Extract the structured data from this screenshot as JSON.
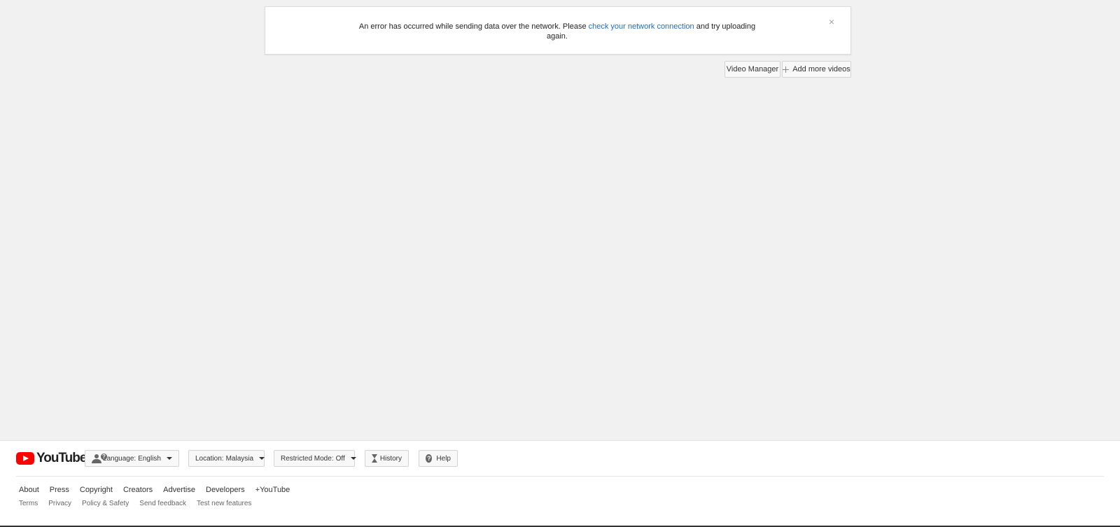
{
  "notice": {
    "text_before": "An error has occurred while sending data over the network. Please ",
    "link_text": "check your network connection",
    "text_after": " and try uploading again.",
    "close_glyph": "×"
  },
  "actions": {
    "video_manager": "Video Manager",
    "add_more_videos": "Add more videos"
  },
  "footer": {
    "logo_text": "YouTube",
    "language_label": "Language:",
    "language_value": "English",
    "location_label": "Location:",
    "location_value": "Malaysia",
    "restricted_label": "Restricted Mode:",
    "restricted_value": "Off",
    "history": "History",
    "help": "Help",
    "help_glyph": "?",
    "people_glyph": "?",
    "primary_links": [
      "About",
      "Press",
      "Copyright",
      "Creators",
      "Advertise",
      "Developers",
      "+YouTube"
    ],
    "secondary_links": [
      "Terms",
      "Privacy",
      "Policy & Safety",
      "Send feedback",
      "Test new features"
    ]
  },
  "colors": {
    "background": "#f1f1f1",
    "link": "#1b6fbf",
    "brand_red": "#ff0000"
  },
  "icons": {
    "close": "close-icon",
    "plus": "plus-icon",
    "play": "youtube-play-icon",
    "language": "people-question-icon",
    "caret": "caret-down-icon",
    "history": "hourglass-icon",
    "help": "help-circle-icon"
  }
}
